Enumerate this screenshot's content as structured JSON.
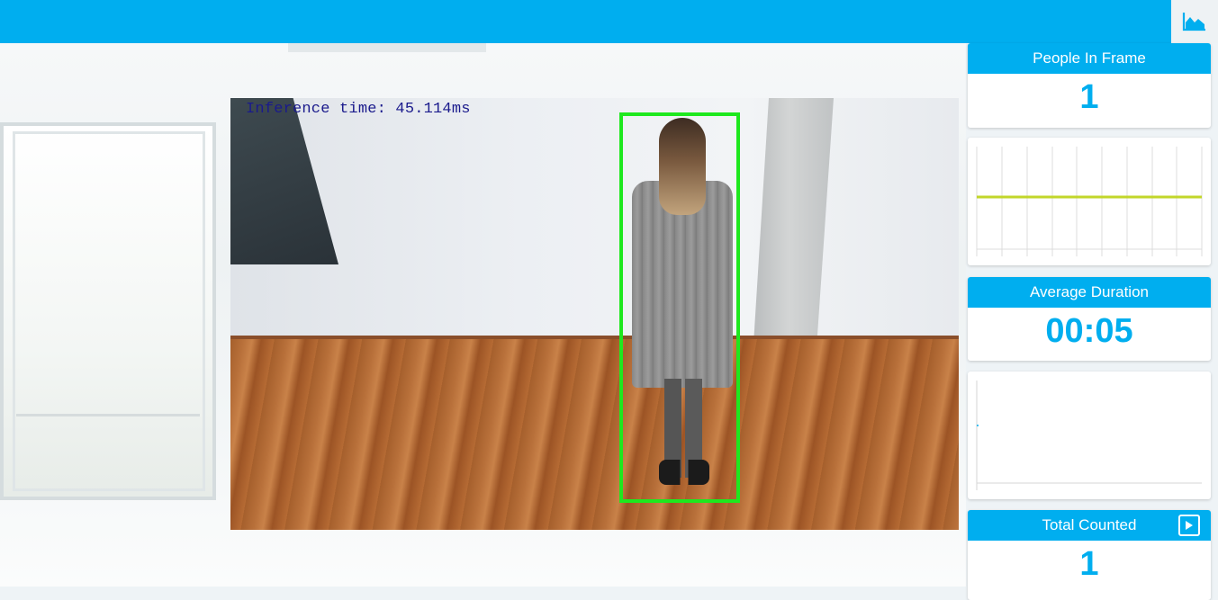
{
  "topbar": {
    "background": "#00aeef",
    "chart_toggle_icon": "area-chart-icon"
  },
  "video": {
    "overlay_text": "Inference time: 45.114ms",
    "bbox_color": "#1ee81e"
  },
  "cards": {
    "people_in_frame": {
      "label": "People In Frame",
      "value": "1"
    },
    "average_duration": {
      "label": "Average Duration",
      "value": "00:05"
    },
    "total_counted": {
      "label": "Total Counted",
      "value": "1",
      "icon": "play-icon"
    }
  },
  "colors": {
    "accent": "#00aeef",
    "series_line": "#c2d62a"
  }
}
